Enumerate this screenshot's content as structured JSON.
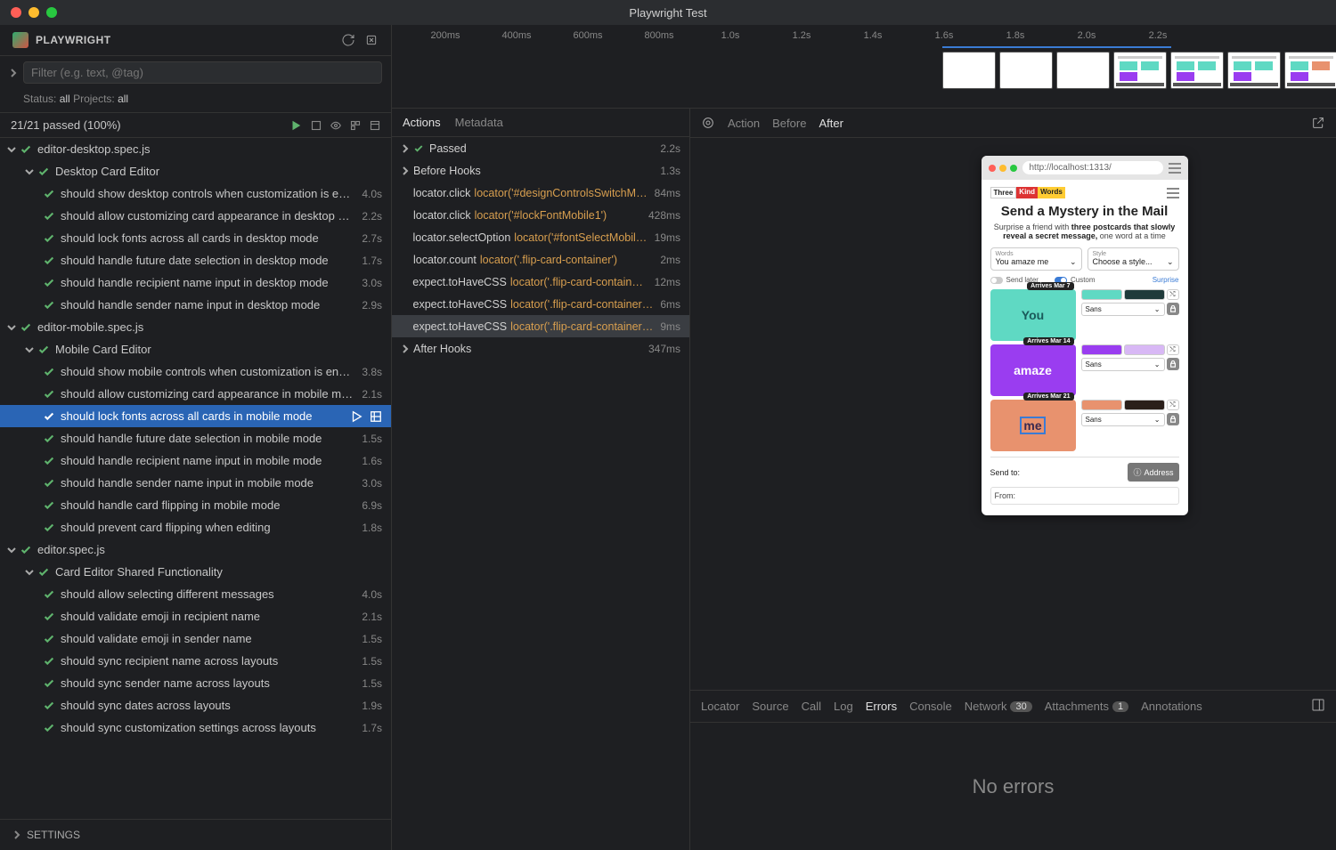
{
  "window_title": "Playwright Test",
  "app_name": "PLAYWRIGHT",
  "filter_placeholder": "Filter (e.g. text, @tag)",
  "status_label": "Status:",
  "status_value": "all",
  "projects_label": "Projects:",
  "projects_value": "all",
  "summary": "21/21 passed (100%)",
  "settings_label": "SETTINGS",
  "tree": [
    {
      "type": "file",
      "label": "editor-desktop.spec.js",
      "time": "",
      "indent": 0,
      "expanded": true
    },
    {
      "type": "suite",
      "label": "Desktop Card Editor",
      "time": "",
      "indent": 1,
      "expanded": true
    },
    {
      "type": "test",
      "label": "should show desktop controls when customization is enabl...",
      "time": "4.0s",
      "indent": 2
    },
    {
      "type": "test",
      "label": "should allow customizing card appearance in desktop mode",
      "time": "2.2s",
      "indent": 2
    },
    {
      "type": "test",
      "label": "should lock fonts across all cards in desktop mode",
      "time": "2.7s",
      "indent": 2
    },
    {
      "type": "test",
      "label": "should handle future date selection in desktop mode",
      "time": "1.7s",
      "indent": 2
    },
    {
      "type": "test",
      "label": "should handle recipient name input in desktop mode",
      "time": "3.0s",
      "indent": 2
    },
    {
      "type": "test",
      "label": "should handle sender name input in desktop mode",
      "time": "2.9s",
      "indent": 2
    },
    {
      "type": "file",
      "label": "editor-mobile.spec.js",
      "time": "",
      "indent": 0,
      "expanded": true
    },
    {
      "type": "suite",
      "label": "Mobile Card Editor",
      "time": "",
      "indent": 1,
      "expanded": true
    },
    {
      "type": "test",
      "label": "should show mobile controls when customization is enabled",
      "time": "3.8s",
      "indent": 2
    },
    {
      "type": "test",
      "label": "should allow customizing card appearance in mobile mode",
      "time": "2.1s",
      "indent": 2
    },
    {
      "type": "test",
      "label": "should lock fonts across all cards in mobile mode",
      "time": "",
      "indent": 2,
      "selected": true
    },
    {
      "type": "test",
      "label": "should handle future date selection in mobile mode",
      "time": "1.5s",
      "indent": 2
    },
    {
      "type": "test",
      "label": "should handle recipient name input in mobile mode",
      "time": "1.6s",
      "indent": 2
    },
    {
      "type": "test",
      "label": "should handle sender name input in mobile mode",
      "time": "3.0s",
      "indent": 2
    },
    {
      "type": "test",
      "label": "should handle card flipping in mobile mode",
      "time": "6.9s",
      "indent": 2
    },
    {
      "type": "test",
      "label": "should prevent card flipping when editing",
      "time": "1.8s",
      "indent": 2
    },
    {
      "type": "file",
      "label": "editor.spec.js",
      "time": "",
      "indent": 0,
      "expanded": true
    },
    {
      "type": "suite",
      "label": "Card Editor Shared Functionality",
      "time": "",
      "indent": 1,
      "expanded": true
    },
    {
      "type": "test",
      "label": "should allow selecting different messages",
      "time": "4.0s",
      "indent": 2
    },
    {
      "type": "test",
      "label": "should validate emoji in recipient name",
      "time": "2.1s",
      "indent": 2
    },
    {
      "type": "test",
      "label": "should validate emoji in sender name",
      "time": "1.5s",
      "indent": 2
    },
    {
      "type": "test",
      "label": "should sync recipient name across layouts",
      "time": "1.5s",
      "indent": 2
    },
    {
      "type": "test",
      "label": "should sync sender name across layouts",
      "time": "1.5s",
      "indent": 2
    },
    {
      "type": "test",
      "label": "should sync dates across layouts",
      "time": "1.9s",
      "indent": 2
    },
    {
      "type": "test",
      "label": "should sync customization settings across layouts",
      "time": "1.7s",
      "indent": 2
    }
  ],
  "timeline_ticks": [
    "200ms",
    "400ms",
    "600ms",
    "800ms",
    "1.0s",
    "1.2s",
    "1.4s",
    "1.6s",
    "1.8s",
    "2.0s",
    "2.2s"
  ],
  "actions_tabs": [
    "Actions",
    "Metadata"
  ],
  "actions": [
    {
      "chev": true,
      "check": true,
      "name": "Passed",
      "loc": "",
      "time": "2.2s"
    },
    {
      "chev": true,
      "name": "Before Hooks",
      "loc": "",
      "time": "1.3s"
    },
    {
      "name": "locator.click",
      "loc": "locator('#designControlsSwitchMo...",
      "time": "84ms"
    },
    {
      "name": "locator.click",
      "loc": "locator('#lockFontMobile1')",
      "time": "428ms"
    },
    {
      "name": "locator.selectOption",
      "loc": "locator('#fontSelectMobile1')",
      "time": "19ms"
    },
    {
      "name": "locator.count",
      "loc": "locator('.flip-card-container')",
      "time": "2ms"
    },
    {
      "name": "expect.toHaveCSS",
      "loc": "locator('.flip-card-container')...",
      "time": "12ms"
    },
    {
      "name": "expect.toHaveCSS",
      "loc": "locator('.flip-card-container')....",
      "time": "6ms"
    },
    {
      "name": "expect.toHaveCSS",
      "loc": "locator('.flip-card-container')....",
      "time": "9ms",
      "selected": true
    },
    {
      "chev": true,
      "name": "After Hooks",
      "loc": "",
      "time": "347ms"
    }
  ],
  "preview_tabs": [
    "Action",
    "Before",
    "After"
  ],
  "preview_url": "http://localhost:1313/",
  "preview": {
    "logo": [
      "Three",
      "Kind",
      "Words"
    ],
    "h1": "Send a Mystery in the Mail",
    "sub_pre": "Surprise a friend with ",
    "sub_bold": "three postcards that slowly reveal a secret message,",
    "sub_post": " one word at a time",
    "words_label": "Words",
    "words_value": "You amaze me",
    "style_label": "Style",
    "style_value": "Choose a style...",
    "send_later": "Send later",
    "custom": "Custom",
    "surprise": "Surprise",
    "cards": [
      {
        "word": "You",
        "badge": "Arrives Mar 7",
        "bg": "#5fd9c3",
        "fg": "#1a5a5a",
        "sw1": "#5fd9c3",
        "sw2": "#1f3a3a"
      },
      {
        "word": "amaze",
        "badge": "Arrives Mar 14",
        "bg": "#9a3df0",
        "fg": "#fff",
        "sw1": "#9a3df0",
        "sw2": "#d8b8f5"
      },
      {
        "word": "me",
        "badge": "Arrives Mar 21",
        "bg": "#e8926e",
        "fg": "#3a2a50",
        "sw1": "#e8926e",
        "sw2": "#2a1f1a",
        "sel": true
      }
    ],
    "font": "Sans",
    "send_to": "Send to:",
    "address": "Address",
    "from": "From:"
  },
  "bottom_tabs": [
    {
      "label": "Locator"
    },
    {
      "label": "Source"
    },
    {
      "label": "Call"
    },
    {
      "label": "Log"
    },
    {
      "label": "Errors",
      "active": true
    },
    {
      "label": "Console"
    },
    {
      "label": "Network",
      "badge": "30"
    },
    {
      "label": "Attachments",
      "badge": "1"
    },
    {
      "label": "Annotations"
    }
  ],
  "no_errors": "No errors"
}
